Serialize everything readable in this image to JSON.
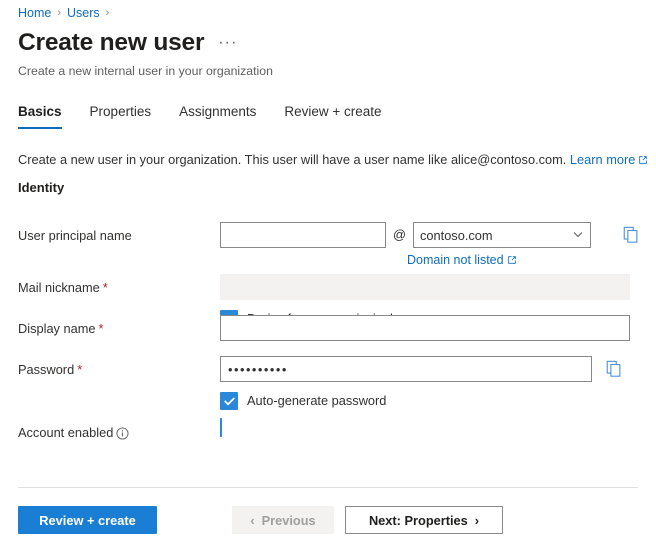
{
  "breadcrumb": {
    "items": [
      {
        "label": "Home"
      },
      {
        "label": "Users"
      }
    ],
    "separator": "›"
  },
  "header": {
    "title": "Create new user",
    "more_actions": "···",
    "subtitle": "Create a new internal user in your organization"
  },
  "tabs": [
    {
      "label": "Basics",
      "active": true
    },
    {
      "label": "Properties",
      "active": false
    },
    {
      "label": "Assignments",
      "active": false
    },
    {
      "label": "Review + create",
      "active": false
    }
  ],
  "intro": {
    "text": "Create a new user in your organization. This user will have a user name like alice@contoso.com.",
    "learn_more": "Learn more"
  },
  "section": {
    "identity_heading": "Identity"
  },
  "fields": {
    "user_principal_name": {
      "label": "User principal name",
      "value": "",
      "placeholder": "",
      "at_separator": "@",
      "domain_value": "contoso.com",
      "domain_options": [
        "contoso.com"
      ],
      "sublink": "Domain not listed",
      "copy_title": "Copy to clipboard"
    },
    "mail_nickname": {
      "label": "Mail nickname",
      "required": "*",
      "value": "",
      "disabled": true,
      "derive_checkbox": {
        "label": "Derive from user principal name",
        "checked": true
      }
    },
    "display_name": {
      "label": "Display name",
      "required": "*",
      "value": "",
      "placeholder": ""
    },
    "password": {
      "label": "Password",
      "required": "*",
      "value": "••••••••••",
      "copy_title": "Copy to clipboard",
      "auto_generate_checkbox": {
        "label": "Auto-generate password",
        "checked": true
      }
    },
    "account_enabled": {
      "label": "Account enabled",
      "info_title": "Information",
      "checked": true
    }
  },
  "footer": {
    "review_create": "Review + create",
    "previous": "Previous",
    "previous_chevron": "‹",
    "next": "Next: Properties",
    "next_chevron": "›"
  },
  "colors": {
    "accent": "#0f6cbd",
    "primary_button": "#1a7fd4",
    "checkbox": "#2b88d8",
    "required_asterisk": "#a4262c",
    "disabled_bg": "#f3f2f1"
  }
}
